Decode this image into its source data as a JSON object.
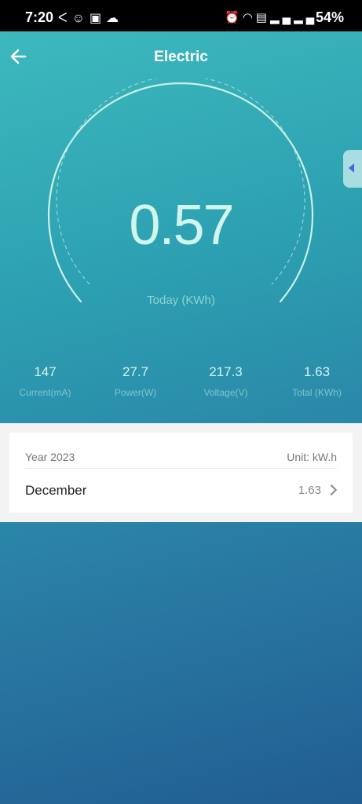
{
  "status_bar": {
    "time": "7:20",
    "battery": "54%",
    "left_icons": [
      "signal-k-icon",
      "cat-icon",
      "lock-notification-icon",
      "cloud-icon"
    ],
    "right_icons": [
      "alarm-icon",
      "wifi-icon",
      "volte-icon",
      "signal-icon",
      "signal-icon"
    ]
  },
  "header": {
    "title": "Electric",
    "back_icon": "arrow-left-icon"
  },
  "gauge": {
    "value": "0.57",
    "label": "Today (KWh)"
  },
  "side_tab": {
    "icon": "triangle-left-icon"
  },
  "stats": [
    {
      "value": "147",
      "label": "Current(mA)"
    },
    {
      "value": "27.7",
      "label": "Power(W)"
    },
    {
      "value": "217.3",
      "label": "Voltage(V)"
    },
    {
      "value": "1.63",
      "label": "Total (KWh)"
    }
  ],
  "history": {
    "year": "Year 2023",
    "unit": "Unit: kW.h",
    "rows": [
      {
        "month": "December",
        "value": "1.63"
      }
    ]
  },
  "colors": {
    "gradient_top": "#3fbcbf",
    "gradient_bottom": "#215d92",
    "reading": "#cff5ec",
    "side_tab_arrow": "#3d6ae0"
  }
}
